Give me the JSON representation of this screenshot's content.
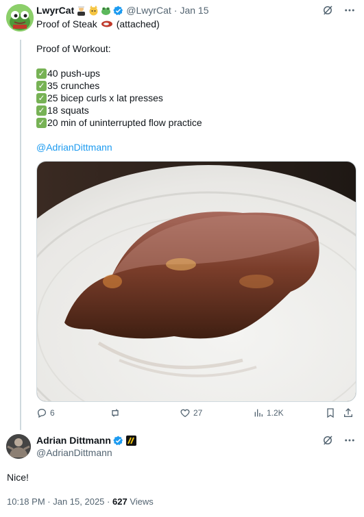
{
  "tweet": {
    "display_name": "LwyrCat",
    "handle": "@LwyrCat",
    "dot": "·",
    "date": "Jan 15",
    "lines": {
      "l1": "Proof of Steak",
      "l1b": "(attached)",
      "l2": "Proof of Workout:",
      "c1": "40 push-ups",
      "c2": "35 crunches",
      "c3": "25 bicep curls x lat presses",
      "c4": "18 squats",
      "c5": "20 min of uninterrupted flow practice",
      "mention": "@AdrianDittmann"
    },
    "actions": {
      "replies": "6",
      "reposts": "",
      "likes": "27",
      "views": "1.2K"
    }
  },
  "reply": {
    "display_name": "Adrian Dittmann",
    "handle": "@AdrianDittmann",
    "text": "Nice!",
    "time": "10:18 PM",
    "date": "Jan 15, 2025",
    "views_count": "627",
    "views_label": "Views"
  },
  "colors": {
    "accent": "#1d9bf0",
    "muted": "#536471",
    "text": "#0f1419",
    "check": "#77b255"
  },
  "icons": [
    "grok-icon",
    "more-icon",
    "reply-icon",
    "repost-icon",
    "like-icon",
    "views-icon",
    "bookmark-icon",
    "share-icon",
    "verified-icon"
  ]
}
